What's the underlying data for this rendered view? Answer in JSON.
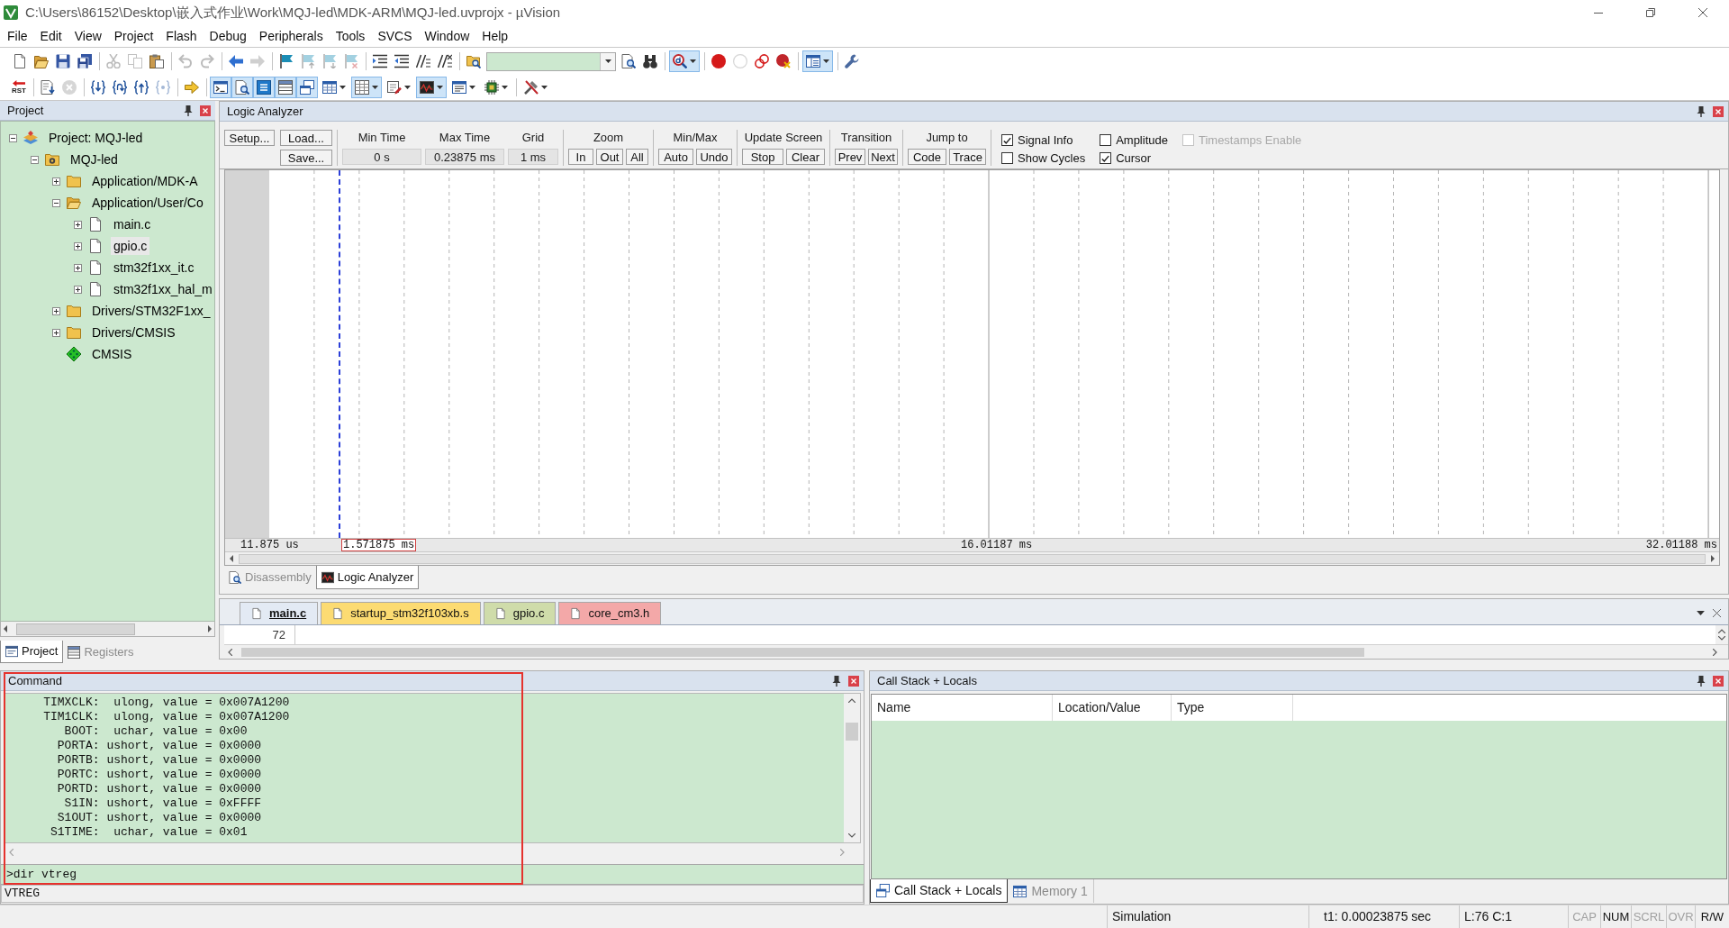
{
  "window": {
    "title": "C:\\Users\\86152\\Desktop\\嵌入式作业\\Work\\MQJ-led\\MDK-ARM\\MQJ-led.uvprojx - µVision"
  },
  "menu": [
    "File",
    "Edit",
    "View",
    "Project",
    "Flash",
    "Debug",
    "Peripherals",
    "Tools",
    "SVCS",
    "Window",
    "Help"
  ],
  "toolbars": [
    [
      {
        "kind": "button",
        "disabled": false,
        "on": false
      },
      {
        "kind": "button",
        "disabled": false,
        "on": false
      },
      {
        "kind": "button",
        "disabled": false,
        "on": false
      },
      {
        "kind": "button",
        "disabled": false,
        "on": false
      },
      {
        "kind": "separator"
      },
      {
        "kind": "button",
        "disabled": true,
        "on": false
      },
      {
        "kind": "button",
        "disabled": true,
        "on": false
      },
      {
        "kind": "button",
        "disabled": false,
        "on": false
      },
      {
        "kind": "separator"
      },
      {
        "kind": "button",
        "disabled": true,
        "on": false
      },
      {
        "kind": "button",
        "disabled": true,
        "on": false
      },
      {
        "kind": "separator"
      },
      {
        "kind": "button",
        "disabled": false,
        "on": false
      },
      {
        "kind": "button",
        "disabled": true,
        "on": false
      },
      {
        "kind": "separator"
      },
      {
        "kind": "button",
        "disabled": false,
        "on": false
      },
      {
        "kind": "button",
        "disabled": true,
        "on": false
      },
      {
        "kind": "button",
        "disabled": true,
        "on": false
      },
      {
        "kind": "button",
        "disabled": true,
        "on": false
      },
      {
        "kind": "separator"
      },
      {
        "kind": "button",
        "disabled": false,
        "on": false
      },
      {
        "kind": "button",
        "disabled": false,
        "on": false
      },
      {
        "kind": "button",
        "disabled": false,
        "on": false
      },
      {
        "kind": "button",
        "disabled": false,
        "on": false
      },
      {
        "kind": "separator"
      },
      {
        "kind": "button",
        "disabled": false,
        "on": false
      },
      {
        "kind": "combo"
      },
      {
        "kind": "button",
        "disabled": false,
        "on": false
      },
      {
        "kind": "button",
        "disabled": false,
        "on": false
      },
      {
        "kind": "separator"
      },
      {
        "kind": "split",
        "disabled": false,
        "on": true
      },
      {
        "kind": "separator"
      },
      {
        "kind": "button",
        "disabled": false,
        "on": false
      },
      {
        "kind": "button",
        "disabled": true,
        "on": false
      },
      {
        "kind": "button",
        "disabled": false,
        "on": false
      },
      {
        "kind": "button",
        "disabled": false,
        "on": false
      },
      {
        "kind": "separator"
      },
      {
        "kind": "split",
        "disabled": false,
        "on": true
      },
      {
        "kind": "separator"
      },
      {
        "kind": "button",
        "disabled": false,
        "on": false
      }
    ],
    [
      {
        "kind": "button",
        "label": "RST",
        "disabled": false,
        "on": false
      },
      {
        "kind": "separator"
      },
      {
        "kind": "button",
        "disabled": false,
        "on": false
      },
      {
        "kind": "button",
        "disabled": true,
        "on": false
      },
      {
        "kind": "separator"
      },
      {
        "kind": "button",
        "disabled": false,
        "on": false
      },
      {
        "kind": "button",
        "disabled": false,
        "on": false
      },
      {
        "kind": "button",
        "disabled": false,
        "on": false
      },
      {
        "kind": "button",
        "disabled": true,
        "on": false
      },
      {
        "kind": "separator"
      },
      {
        "kind": "button",
        "disabled": false,
        "on": false
      },
      {
        "kind": "separator"
      },
      {
        "kind": "button",
        "disabled": false,
        "on": true
      },
      {
        "kind": "button",
        "disabled": false,
        "on": true
      },
      {
        "kind": "button",
        "disabled": false,
        "on": true
      },
      {
        "kind": "button",
        "disabled": false,
        "on": true
      },
      {
        "kind": "button",
        "disabled": false,
        "on": true
      },
      {
        "kind": "split",
        "disabled": false,
        "on": false
      },
      {
        "kind": "split",
        "disabled": false,
        "on": true
      },
      {
        "kind": "split",
        "disabled": false,
        "on": false
      },
      {
        "kind": "split",
        "disabled": false,
        "on": true
      },
      {
        "kind": "split",
        "disabled": false,
        "on": false
      },
      {
        "kind": "split",
        "disabled": false,
        "on": false
      },
      {
        "kind": "separator"
      },
      {
        "kind": "split",
        "disabled": false,
        "on": false
      }
    ]
  ],
  "project_panel": {
    "title": "Project",
    "tree": [
      {
        "label": "Project: MQJ-led",
        "kind": "project",
        "expanded": true,
        "selected": false,
        "children": [
          {
            "label": "MQJ-led",
            "kind": "target",
            "expanded": true,
            "selected": false,
            "children": [
              {
                "label": "Application/MDK-A",
                "kind": "group",
                "expanded": false,
                "selected": false
              },
              {
                "label": "Application/User/Co",
                "kind": "group",
                "expanded": true,
                "selected": false,
                "children": [
                  {
                    "label": "main.c",
                    "kind": "file",
                    "expanded": false,
                    "selected": false
                  },
                  {
                    "label": "gpio.c",
                    "kind": "file",
                    "expanded": false,
                    "selected": true
                  },
                  {
                    "label": "stm32f1xx_it.c",
                    "kind": "file",
                    "expanded": false,
                    "selected": false
                  },
                  {
                    "label": "stm32f1xx_hal_m",
                    "kind": "file",
                    "expanded": false,
                    "selected": false
                  }
                ]
              },
              {
                "label": "Drivers/STM32F1xx_",
                "kind": "group",
                "expanded": false,
                "selected": false
              },
              {
                "label": "Drivers/CMSIS",
                "kind": "group",
                "expanded": false,
                "selected": false
              },
              {
                "label": "CMSIS",
                "kind": "component",
                "selected": false
              }
            ]
          }
        ]
      }
    ],
    "tabs": [
      {
        "label": "Project",
        "selected": true
      },
      {
        "label": "Registers",
        "selected": false
      }
    ]
  },
  "logic_analyzer": {
    "title": "Logic Analyzer",
    "file_buttons": [
      "Setup...",
      "Load...",
      "Save..."
    ],
    "fields": [
      {
        "label": "Min Time",
        "value": "0 s"
      },
      {
        "label": "Max Time",
        "value": "0.23875 ms"
      },
      {
        "label": "Grid",
        "value": "1 ms"
      }
    ],
    "groups": [
      {
        "label": "Zoom",
        "buttons": [
          "In",
          "Out",
          "All"
        ]
      },
      {
        "label": "Min/Max",
        "buttons": [
          "Auto",
          "Undo"
        ]
      },
      {
        "label": "Update Screen",
        "buttons": [
          "Stop",
          "Clear"
        ]
      },
      {
        "label": "Transition",
        "buttons": [
          "Prev",
          "Next"
        ]
      },
      {
        "label": "Jump to",
        "buttons": [
          "Code",
          "Trace"
        ]
      }
    ],
    "options": [
      {
        "label": "Signal Info",
        "checked": true,
        "disabled": false
      },
      {
        "label": "Show Cycles",
        "checked": false,
        "disabled": false
      },
      {
        "label": "Amplitude",
        "checked": false,
        "disabled": false
      },
      {
        "label": "Cursor",
        "checked": true,
        "disabled": false
      },
      {
        "label": "Timestamps Enable",
        "checked": false,
        "disabled": true
      }
    ],
    "time_axis": [
      {
        "kind": "start",
        "text": "11.875 us"
      },
      {
        "kind": "cursor",
        "text": "1.571875 ms"
      },
      {
        "kind": "middle",
        "text": "16.01187 ms"
      },
      {
        "kind": "end",
        "text": "32.01188 ms"
      }
    ],
    "view_tabs": [
      {
        "label": "Disassembly",
        "selected": false
      },
      {
        "label": "Logic Analyzer",
        "selected": true
      }
    ]
  },
  "editor": {
    "tabs": [
      {
        "label": "main.c",
        "selected": true,
        "color": "#e3eaf4"
      },
      {
        "label": "startup_stm32f103xb.s",
        "selected": false,
        "color": "#fcdb72"
      },
      {
        "label": "gpio.c",
        "selected": false,
        "color": "#cfdcaa"
      },
      {
        "label": "core_cm3.h",
        "selected": false,
        "color": "#f3a8a8"
      }
    ],
    "line_number": "72"
  },
  "command": {
    "title": "Command",
    "highlighted": true,
    "output": [
      "    TIMXCLK:  ulong, value = 0x007A1200",
      "    TIM1CLK:  ulong, value = 0x007A1200",
      "       BOOT:  uchar, value = 0x00",
      "      PORTA: ushort, value = 0x0000",
      "      PORTB: ushort, value = 0x0000",
      "      PORTC: ushort, value = 0x0000",
      "      PORTD: ushort, value = 0x0000",
      "       S1IN: ushort, value = 0xFFFF",
      "      S1OUT: ushort, value = 0x0000",
      "     S1TIME:  uchar, value = 0x01"
    ],
    "input": ">dir vtreg",
    "hint": "VTREG"
  },
  "call_stack": {
    "title": "Call Stack + Locals",
    "columns": [
      "Name",
      "Location/Value",
      "Type"
    ],
    "tabs": [
      {
        "label": "Call Stack + Locals",
        "selected": true
      },
      {
        "label": "Memory 1",
        "selected": false
      }
    ]
  },
  "status_bar": {
    "mode": "Simulation",
    "time": "t1: 0.00023875 sec",
    "position": "L:76 C:1",
    "indicators": [
      {
        "label": "CAP",
        "on": false
      },
      {
        "label": "NUM",
        "on": true
      },
      {
        "label": "SCRL",
        "on": false
      },
      {
        "label": "OVR",
        "on": false
      },
      {
        "label": "R/W",
        "on": true
      }
    ]
  }
}
